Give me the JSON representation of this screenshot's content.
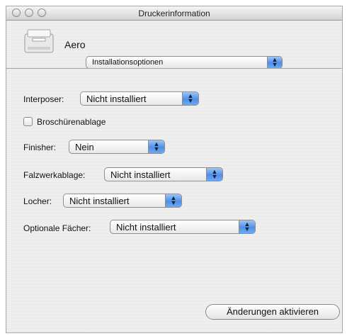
{
  "window": {
    "title": "Druckerinformation"
  },
  "printer": {
    "name": "Aero",
    "icon": "printer-icon"
  },
  "section_selector": {
    "value": "Installationsoptionen"
  },
  "options": {
    "interposer": {
      "label": "Interposer:",
      "value": "Nicht installiert"
    },
    "booklet_tray": {
      "label": "Broschürenablage",
      "checked": false
    },
    "finisher": {
      "label": "Finisher:",
      "value": "Nein"
    },
    "folding_unit": {
      "label": "Falzwerkablage:",
      "value": "Nicht installiert"
    },
    "puncher": {
      "label": "Locher:",
      "value": "Nicht installiert"
    },
    "optional_trays": {
      "label": "Optionale Fächer:",
      "value": "Nicht installiert"
    }
  },
  "actions": {
    "apply_label": "Änderungen aktivieren"
  },
  "colors": {
    "window_bg": "#ececec",
    "popup_arrow_blue": "#4f8fe5"
  }
}
